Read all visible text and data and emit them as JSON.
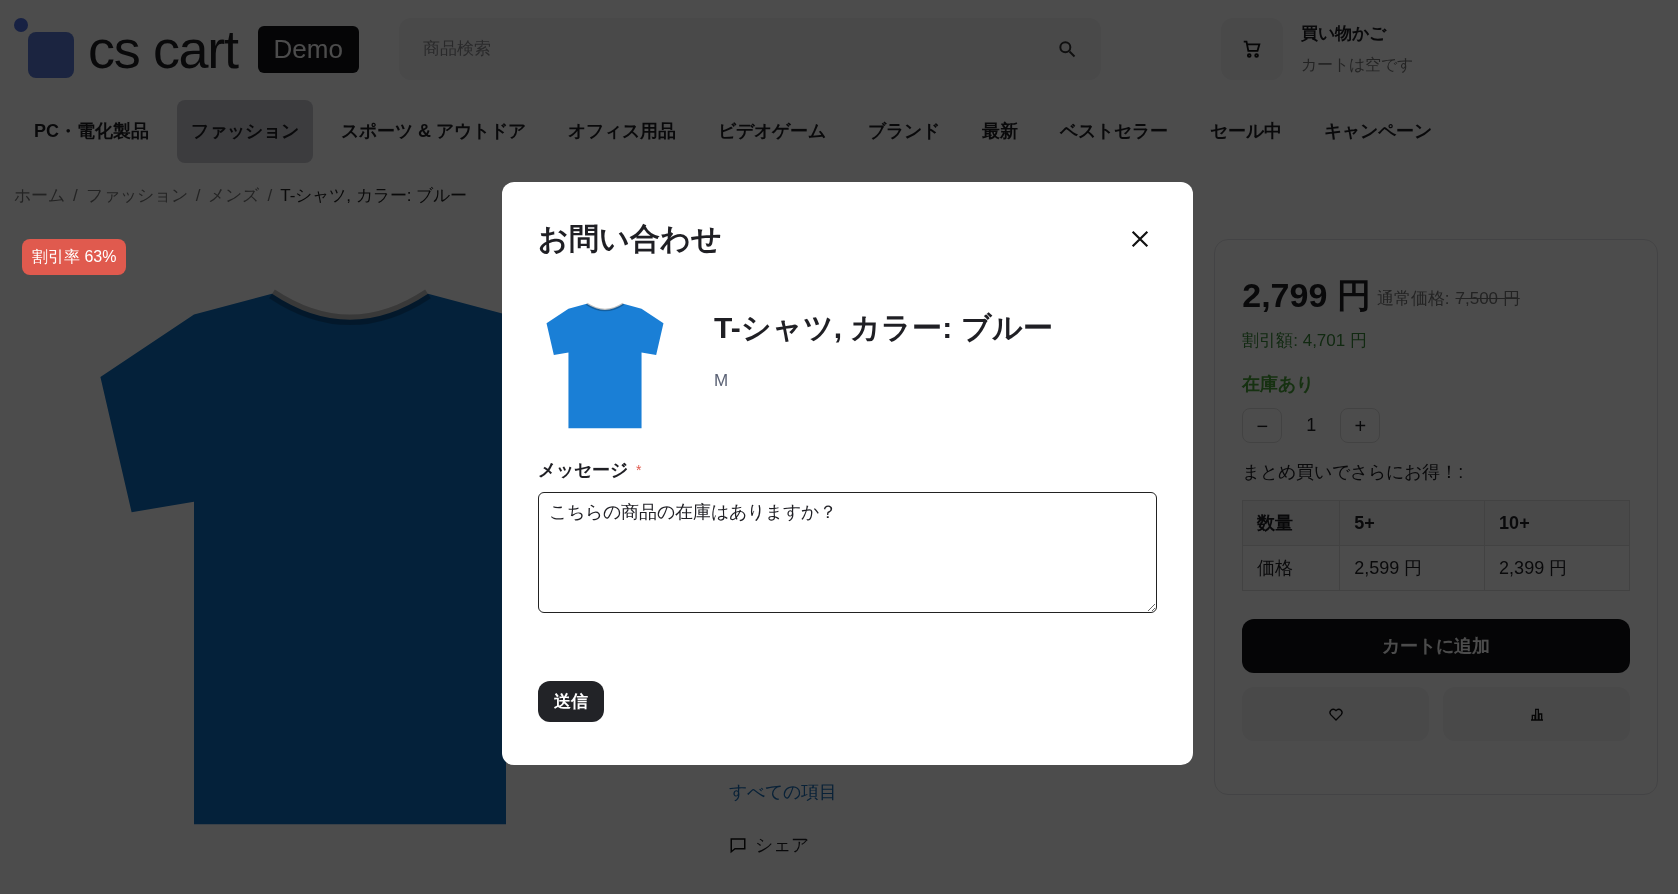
{
  "header": {
    "logo_text": "cs cart",
    "logo_badge": "Demo",
    "search": {
      "placeholder": "商品検索"
    },
    "cart": {
      "title": "買い物かご",
      "subtitle": "カートは空です"
    }
  },
  "nav": [
    {
      "label": "PC・電化製品",
      "selected": false
    },
    {
      "label": "ファッション",
      "selected": true
    },
    {
      "label": "スポーツ & アウトドア",
      "selected": false
    },
    {
      "label": "オフィス用品",
      "selected": false
    },
    {
      "label": "ビデオゲーム",
      "selected": false
    },
    {
      "label": "ブランド",
      "selected": false
    },
    {
      "label": "最新",
      "selected": false
    },
    {
      "label": "ベストセラー",
      "selected": false
    },
    {
      "label": "セール中",
      "selected": false
    },
    {
      "label": "キャンペーン",
      "selected": false
    }
  ],
  "breadcrumb": [
    "ホーム",
    "ファッション",
    "メンズ",
    "T-シャツ, カラー: ブルー"
  ],
  "breadcrumb_separator": "/",
  "product": {
    "discount_badge": "割引率 63%",
    "all_items_link": "すべての項目",
    "share_label": "シェア"
  },
  "price_panel": {
    "price": "2,799 円",
    "list_price_label": "通常価格:",
    "list_price": "7,500 円",
    "savings": "割引額: 4,701 円",
    "stock": "在庫あり",
    "quantity": "1",
    "minus": "−",
    "plus": "+",
    "bulk_label": "まとめ買いでさらにお得！:",
    "table": {
      "columns": [
        "数量",
        "5+",
        "10+"
      ],
      "rows": [
        [
          "価格",
          "2,599 円",
          "2,399 円"
        ]
      ]
    },
    "add_to_cart": "カートに追加"
  },
  "modal": {
    "title": "お問い合わせ",
    "product_name": "T-シャツ, カラー: ブルー",
    "option": "M",
    "message_label": "メッセージ",
    "required_mark": "*",
    "message": "こちらの商品の在庫はありますか？",
    "submit": "送信"
  }
}
